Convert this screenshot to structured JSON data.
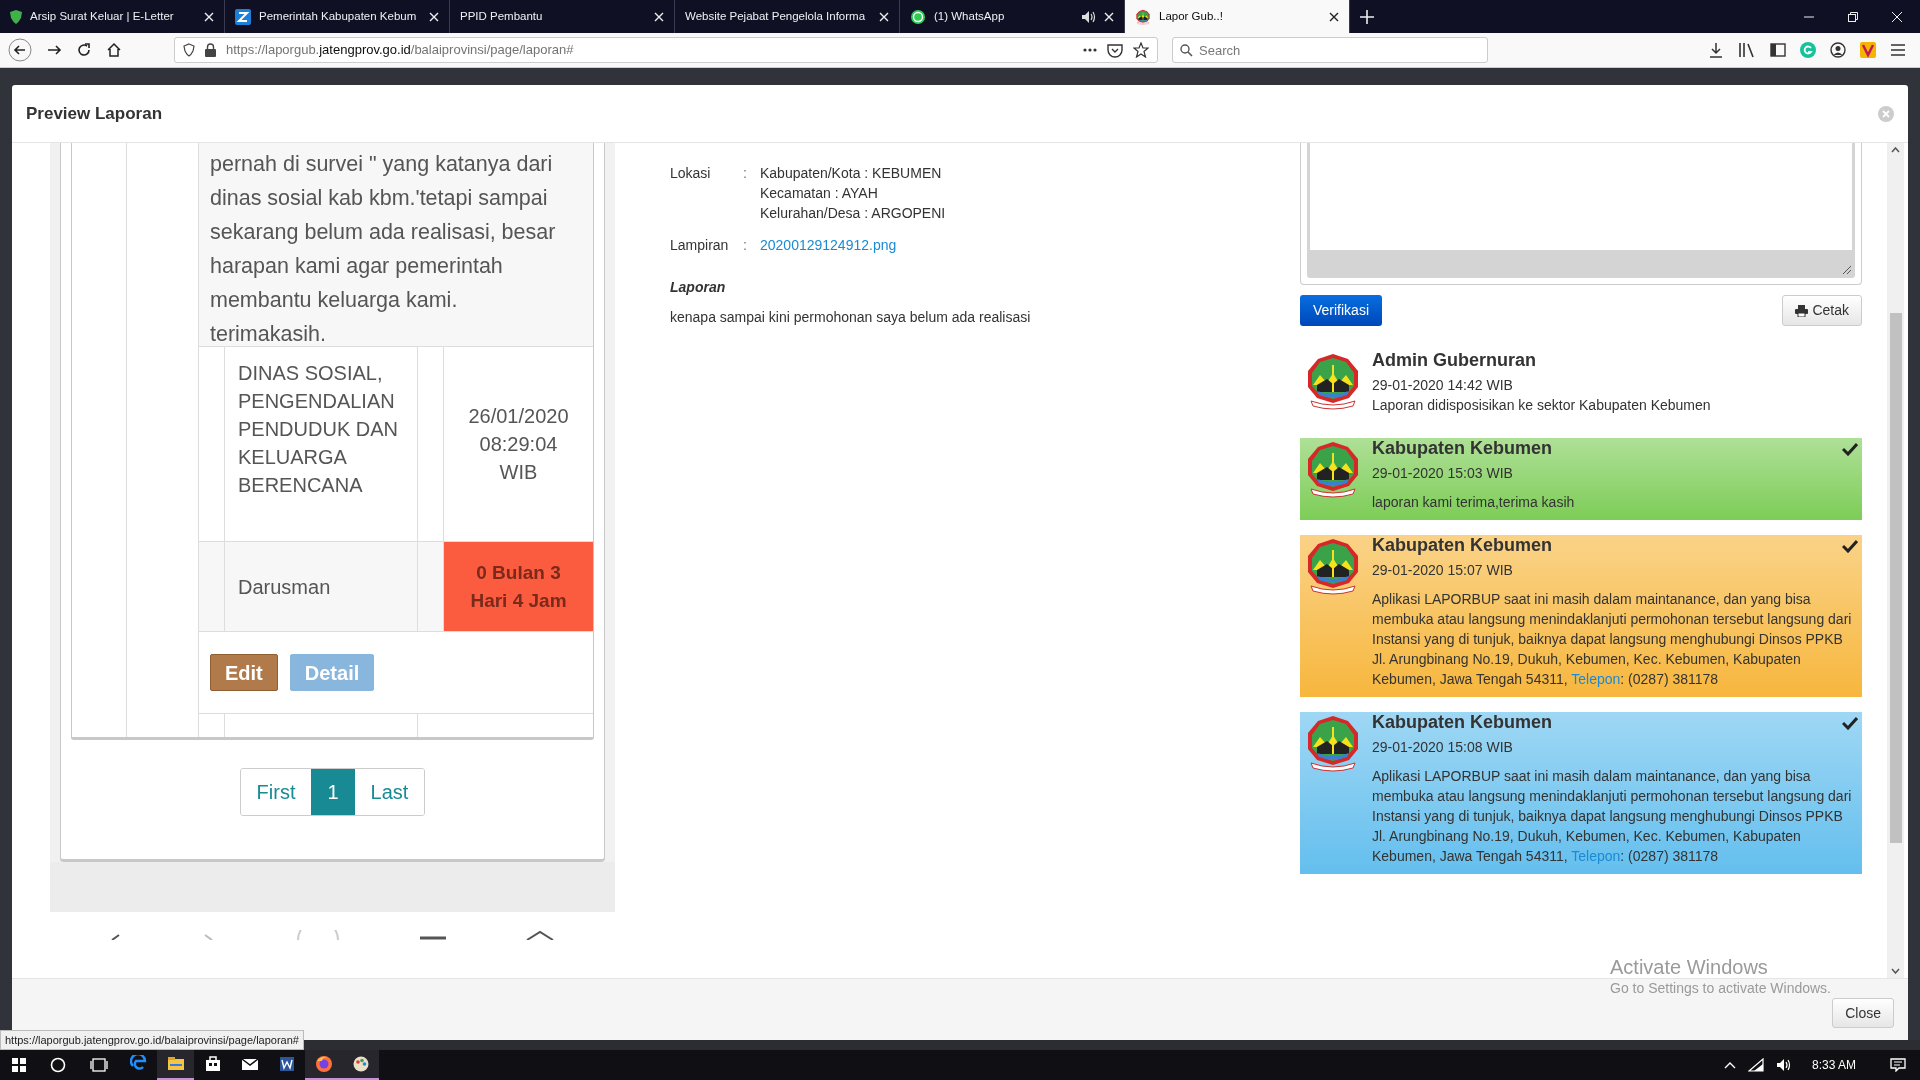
{
  "browser": {
    "tabs": [
      {
        "title": "Arsip Surat Keluar | E-Letter",
        "kind": "shield",
        "selected": false,
        "audio": false
      },
      {
        "title": "Pemerintah Kabupaten Kebum",
        "kind": "square",
        "selected": false,
        "audio": false
      },
      {
        "title": "PPID Pembantu",
        "kind": "none",
        "selected": false,
        "audio": false
      },
      {
        "title": "Website Pejabat Pengelola Informa",
        "kind": "none",
        "selected": false,
        "audio": false
      },
      {
        "title": "(1) WhatsApp",
        "kind": "chat",
        "selected": false,
        "audio": true
      },
      {
        "title": "Lapor Gub..!",
        "kind": "emblem",
        "selected": true,
        "audio": false
      }
    ],
    "url_parts": [
      "https://laporgub.",
      "jatengprov.go.id",
      "/balaiprovinsi/page/laporan#"
    ],
    "search_placeholder": "Search"
  },
  "modal": {
    "title": "Preview Laporan",
    "close": "Close"
  },
  "attachment": {
    "message": "pernah di survei \" yang katanya dari dinas sosial kab kbm.'tetapi sampai sekarang belum ada realisasi, besar harapan kami agar pemerintah membantu keluarga kami. terimakasih.",
    "agency": "DINAS SOSIAL, PENGENDALIAN PENDUDUK DAN KELUARGA BERENCANA",
    "date": "26/01/2020 08:29:04 WIB",
    "officer": "Darusman",
    "elapsed": "0 Bulan 3 Hari 4 Jam",
    "actions": [
      {
        "label": "Edit",
        "kind": "edit"
      },
      {
        "label": "Detail",
        "kind": "detail"
      }
    ],
    "pages": [
      {
        "label": "First",
        "selected": false
      },
      {
        "label": "1",
        "selected": true
      },
      {
        "label": "Last",
        "selected": false
      }
    ]
  },
  "details": {
    "fields": [
      {
        "label": "Lokasi",
        "separator": ":",
        "kind": "text",
        "lines": [
          "Kabupaten/Kota : KEBUMEN",
          "Kecamatan : AYAH",
          "Kelurahan/Desa : ARGOPENI"
        ]
      },
      {
        "label": "Lampiran",
        "separator": ":",
        "kind": "link",
        "lines": [
          "20200129124912.png"
        ]
      }
    ],
    "report_heading": "Laporan",
    "report_text": "kenapa sampai kini permohonan saya belum ada realisasi"
  },
  "actions": {
    "verify": "Verifikasi",
    "print": "Cetak"
  },
  "timeline": [
    {
      "author": "Admin Gubernuran",
      "time": "29-01-2020 14:42 WIB",
      "message": "Laporan didisposisikan ke sektor Kabupaten Kebumen",
      "checked": false
    },
    {
      "author": "Kabupaten Kebumen",
      "time": "29-01-2020 15:03 WIB",
      "message": "laporan kami terima,terima kasih",
      "color": "#7dcd57",
      "checked": true
    },
    {
      "author": "Kabupaten Kebumen",
      "time": "29-01-2020 15:07 WIB",
      "message": "Aplikasi LAPORBUP saat ini masih dalam maintanance, dan yang bisa membuka atau langsung menindaklanjuti permohonan tersebut langsung dari Instansi yang di tunjuk, baiknya dapat langsung menghubungi Dinsos PPKB Jl. Arungbinang No.19, Dukuh, Kebumen, Kec. Kebumen, Kabupaten Kebumen, Jawa Tengah 54311, ",
      "link": "Telepon",
      "after_link": ": (0287) 381178",
      "color": "#f7b73e",
      "checked": true
    },
    {
      "author": "Kabupaten Kebumen",
      "time": "29-01-2020 15:08 WIB",
      "message": "Aplikasi LAPORBUP saat ini masih dalam maintanance, dan yang bisa membuka atau langsung menindaklanjuti permohonan tersebut langsung dari Instansi yang di tunjuk, baiknya dapat langsung menghubungi Dinsos PPKB Jl. Arungbinang No.19, Dukuh, Kebumen, Kec. Kebumen, Kabupaten Kebumen, Jawa Tengah 54311, ",
      "link": "Telepon",
      "after_link": ": (0287) 381178",
      "color": "#64bfee",
      "checked": true
    }
  ],
  "status_url": "https://laporgub.jatengprov.go.id/balaiprovinsi/page/laporan#",
  "os_notice": {
    "title": "Activate Windows",
    "subtitle": "Go to Settings to activate Windows."
  },
  "taskbar": {
    "apps": [
      {
        "kind": "edge",
        "running": false
      },
      {
        "kind": "folder",
        "running": true
      },
      {
        "kind": "store",
        "running": false
      },
      {
        "kind": "mail",
        "running": false
      },
      {
        "kind": "word",
        "running": false
      },
      {
        "kind": "firefox",
        "running": true
      },
      {
        "kind": "paint",
        "running": true
      }
    ],
    "time": "8:33 AM"
  }
}
